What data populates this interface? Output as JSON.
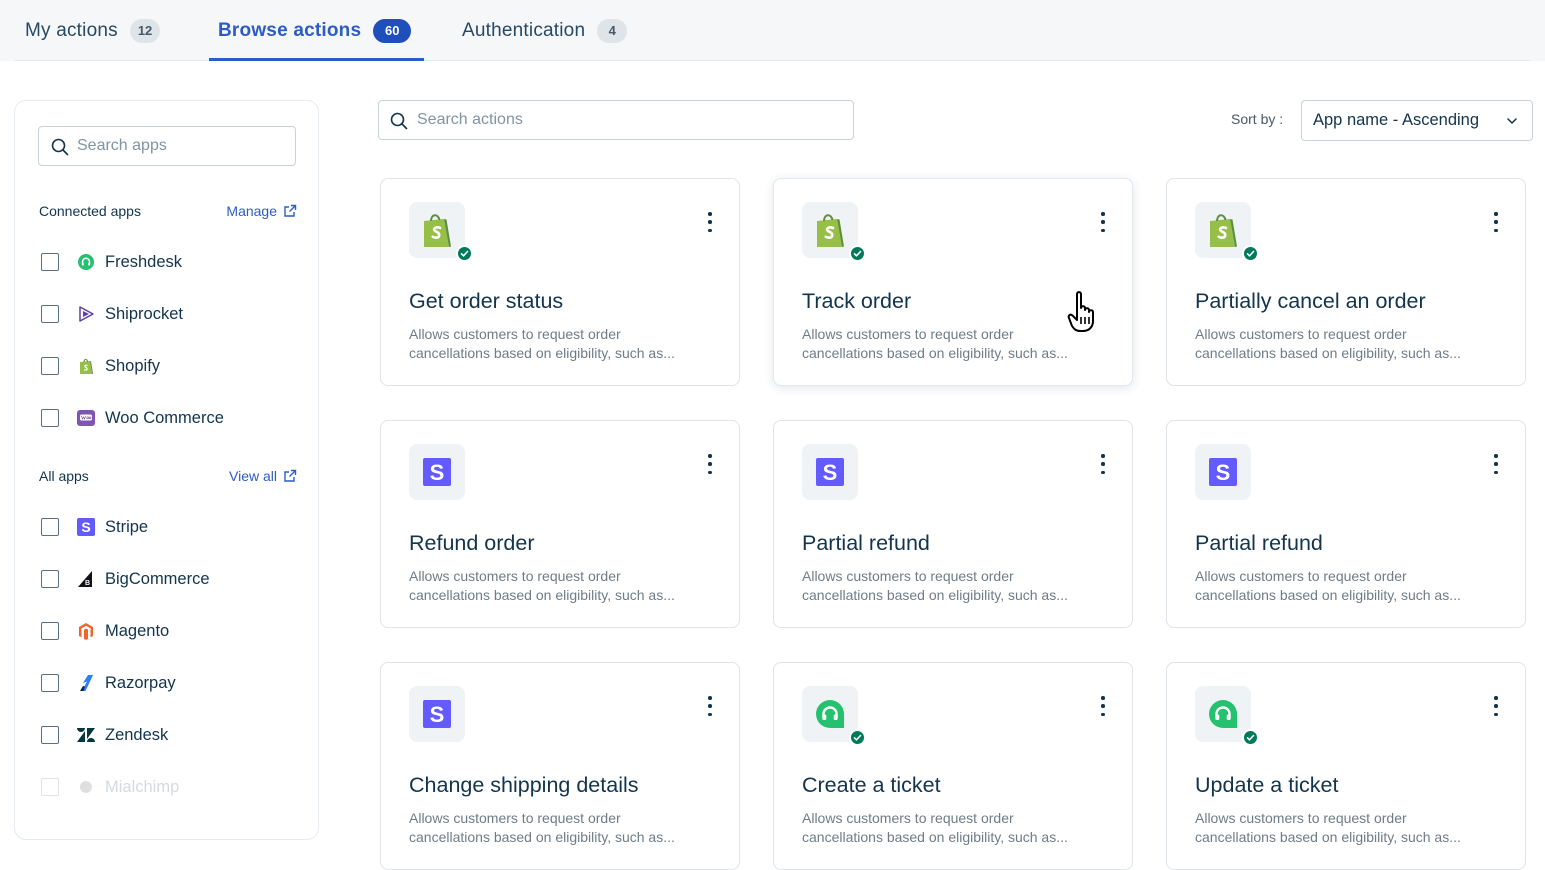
{
  "tabs": [
    {
      "label": "My actions",
      "count": "12"
    },
    {
      "label": "Browse actions",
      "count": "60"
    },
    {
      "label": "Authentication",
      "count": "4"
    }
  ],
  "sidebar": {
    "search_placeholder": "Search apps",
    "connected": {
      "title": "Connected apps",
      "link": "Manage",
      "apps": [
        "Freshdesk",
        "Shiprocket",
        "Shopify",
        "Woo Commerce"
      ]
    },
    "all": {
      "title": "All apps",
      "link": "View all",
      "apps": [
        "Stripe",
        "BigCommerce",
        "Magento",
        "Razorpay",
        "Zendesk",
        "Mialchimp"
      ]
    }
  },
  "main": {
    "search_placeholder": "Search actions",
    "sort_label": "Sort by :",
    "sort_value": "App name - Ascending"
  },
  "cards": [
    {
      "title": "Get order status",
      "desc1": "Allows customers to request order",
      "desc2": "cancellations based on eligibility, such as...",
      "app": "shopify",
      "connected": true
    },
    {
      "title": "Track order",
      "desc1": "Allows customers to request order",
      "desc2": "cancellations based on eligibility, such as...",
      "app": "shopify",
      "connected": true
    },
    {
      "title": "Partially cancel an order",
      "desc1": "Allows customers to request order",
      "desc2": "cancellations based on eligibility, such as...",
      "app": "shopify",
      "connected": true
    },
    {
      "title": "Refund order",
      "desc1": "Allows customers to request order",
      "desc2": "cancellations based on eligibility, such as...",
      "app": "stripe",
      "connected": false
    },
    {
      "title": "Partial refund",
      "desc1": "Allows customers to request order",
      "desc2": "cancellations based on eligibility, such as...",
      "app": "stripe",
      "connected": false
    },
    {
      "title": "Partial refund",
      "desc1": "Allows customers to request order",
      "desc2": "cancellations based on eligibility, such as...",
      "app": "stripe",
      "connected": false
    },
    {
      "title": "Change shipping details",
      "desc1": "Allows customers to request order",
      "desc2": "cancellations based on eligibility, such as...",
      "app": "stripe",
      "connected": false
    },
    {
      "title": "Create a ticket",
      "desc1": "Allows customers to request order",
      "desc2": "cancellations based on eligibility, such as...",
      "app": "freshdesk",
      "connected": true
    },
    {
      "title": "Update a ticket",
      "desc1": "Allows customers to request order",
      "desc2": "cancellations based on eligibility, such as...",
      "app": "freshdesk",
      "connected": true
    }
  ],
  "colors": {
    "accent": "#2c5cc5",
    "connected_badge": "#00795b",
    "shopify": "#95bf47",
    "stripe": "#635bff",
    "freshdesk": "#25c16f"
  }
}
